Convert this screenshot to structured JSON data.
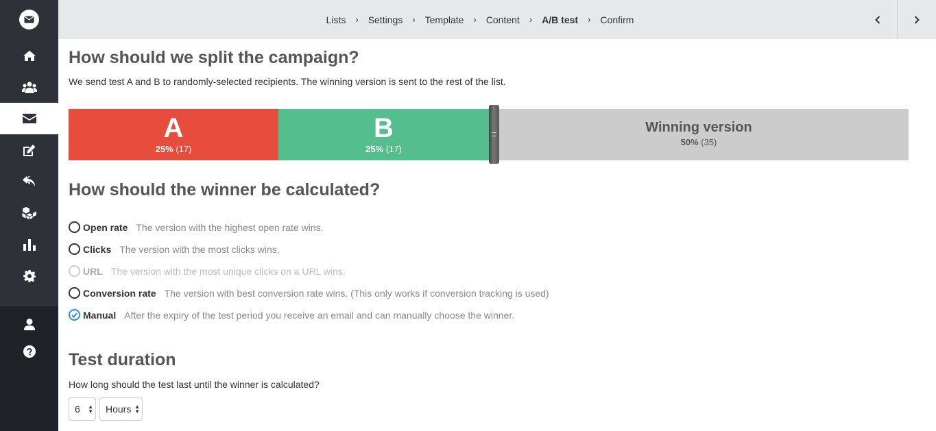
{
  "breadcrumbs": [
    {
      "label": "Lists"
    },
    {
      "label": "Settings"
    },
    {
      "label": "Template"
    },
    {
      "label": "Content"
    },
    {
      "label": "A/B test"
    },
    {
      "label": "Confirm"
    }
  ],
  "current_step": "A/B test",
  "sidebar": {
    "items": [
      {
        "icon": "home-icon"
      },
      {
        "icon": "users-icon"
      },
      {
        "icon": "envelope-icon",
        "active": true
      },
      {
        "icon": "edit-icon"
      },
      {
        "icon": "reply-icon"
      },
      {
        "icon": "cubes-icon"
      },
      {
        "icon": "bar-chart-icon"
      },
      {
        "icon": "gear-icon"
      },
      {
        "icon": "user-icon"
      },
      {
        "icon": "help-icon"
      }
    ]
  },
  "split_section": {
    "title": "How should we split the campaign?",
    "description": "We send test A and B to randomly-selected recipients. The winning version is sent to the rest of the list.",
    "segments": {
      "a": {
        "label": "A",
        "percent": "25%",
        "count": "(17)",
        "color": "#e84c3d"
      },
      "b": {
        "label": "B",
        "percent": "25%",
        "count": "(17)",
        "color": "#55be8f"
      },
      "winner": {
        "label": "Winning version",
        "percent": "50%",
        "count": "(35)",
        "color": "#cccccc"
      }
    }
  },
  "winner_section": {
    "title": "How should the winner be calculated?",
    "options": [
      {
        "label": "Open rate",
        "hint": "The version with the highest open rate wins.",
        "checked": false,
        "disabled": false
      },
      {
        "label": "Clicks",
        "hint": "The version with the most clicks wins.",
        "checked": false,
        "disabled": false
      },
      {
        "label": "URL",
        "hint": "The version with the most unique clicks on a URL wins.",
        "checked": false,
        "disabled": true
      },
      {
        "label": "Conversion rate",
        "hint": "The version with best conversion rate wins. (This only works if conversion tracking is used)",
        "checked": false,
        "disabled": false
      },
      {
        "label": "Manual",
        "hint": "After the expiry of the test period you receive an email and can manually choose the winner.",
        "checked": true,
        "disabled": false
      }
    ]
  },
  "duration_section": {
    "title": "Test duration",
    "description": "How long should the test last until the winner is calculated?",
    "amount": "6",
    "unit": "Hours"
  },
  "colors": {
    "accent": "#2a8fd6",
    "sidebar": "#2e3238"
  }
}
